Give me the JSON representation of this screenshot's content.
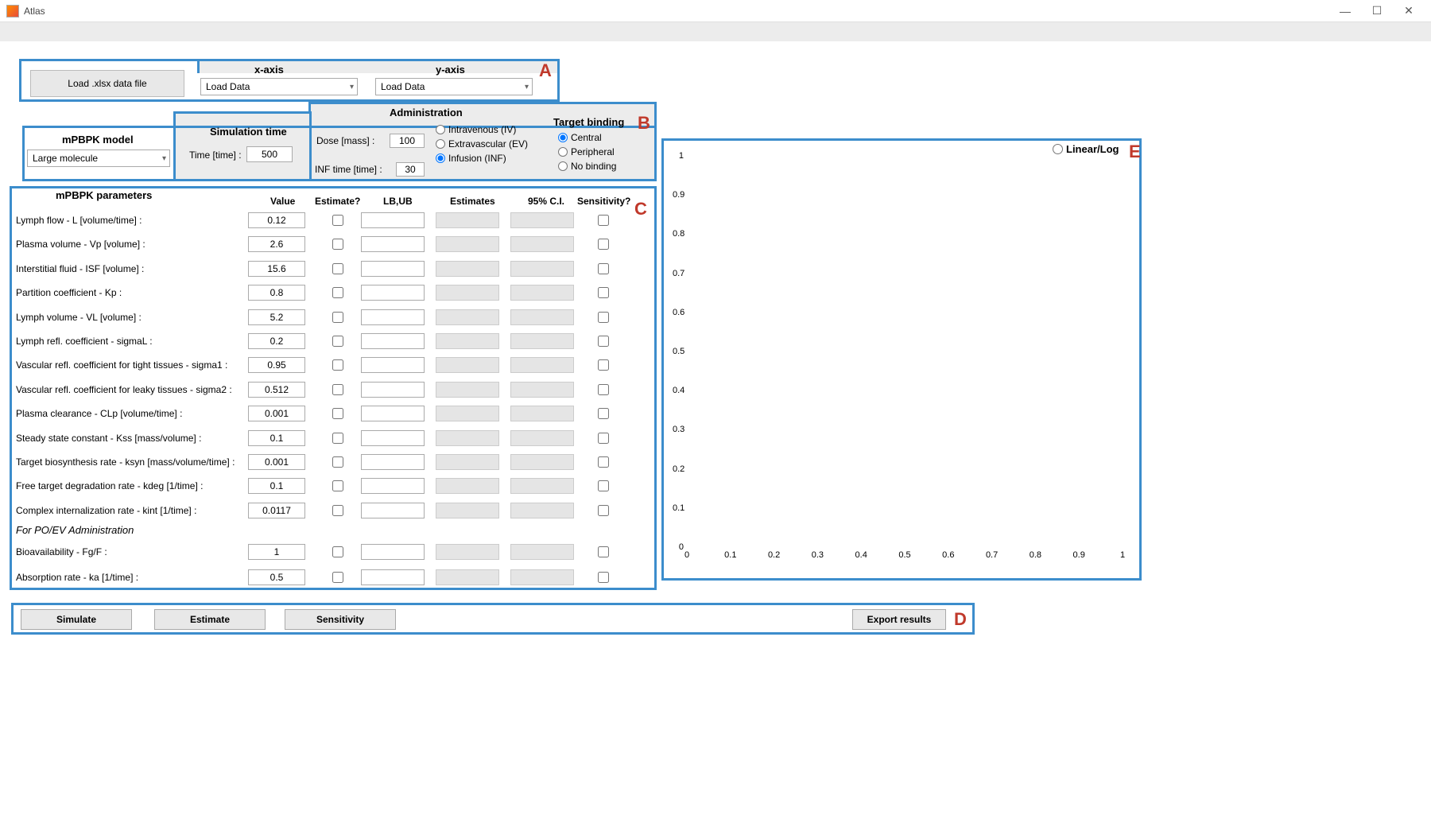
{
  "window": {
    "title": "Atlas"
  },
  "sectionA": {
    "load_button": "Load .xlsx data file",
    "xaxis_label": "x-axis",
    "yaxis_label": "y-axis",
    "xaxis_value": "Load Data",
    "yaxis_value": "Load Data",
    "letter": "A"
  },
  "sectionB": {
    "letter": "B",
    "model_title": "mPBPK model",
    "model_value": "Large molecule",
    "simtime_title": "Simulation time",
    "time_label": "Time [time] :",
    "time_value": "500",
    "admin_title": "Administration",
    "dose_label": "Dose [mass] :",
    "dose_value": "100",
    "inf_label": "INF time [time] :",
    "inf_value": "30",
    "admin_options": {
      "iv": "Intravenous (IV)",
      "ev": "Extravascular (EV)",
      "inf": "Infusion (INF)"
    },
    "admin_selected": "inf",
    "target_title": "Target binding",
    "target_options": {
      "central": "Central",
      "peripheral": "Peripheral",
      "none": "No binding"
    },
    "target_selected": "central"
  },
  "sectionC": {
    "letter": "C",
    "title": "mPBPK parameters",
    "headers": {
      "value": "Value",
      "estimate": "Estimate?",
      "lbub": "LB,UB",
      "estimates": "Estimates",
      "ci": "95% C.I.",
      "sensitivity": "Sensitivity?"
    },
    "params": [
      {
        "label": "Lymph flow - L [volume/time] :",
        "value": "0.12"
      },
      {
        "label": "Plasma volume - Vp [volume] :",
        "value": "2.6"
      },
      {
        "label": "Interstitial fluid - ISF [volume] :",
        "value": "15.6"
      },
      {
        "label": "Partition coefficient - Kp :",
        "value": "0.8"
      },
      {
        "label": "Lymph volume - VL [volume] :",
        "value": "5.2"
      },
      {
        "label": "Lymph refl. coefficient - sigmaL :",
        "value": "0.2"
      },
      {
        "label": "Vascular refl. coefficient for tight tissues - sigma1 :",
        "value": "0.95"
      },
      {
        "label": "Vascular refl. coefficient for leaky tissues - sigma2 :",
        "value": "0.512"
      },
      {
        "label": "Plasma clearance - CLp [volume/time] :",
        "value": "0.001"
      },
      {
        "label": "Steady state constant - Kss [mass/volume] :",
        "value": "0.1"
      },
      {
        "label": "Target biosynthesis rate - ksyn [mass/volume/time] :",
        "value": "0.001"
      },
      {
        "label": "Free target degradation rate - kdeg [1/time] :",
        "value": "0.1"
      },
      {
        "label": "Complex internalization rate - kint [1/time] :",
        "value": "0.0117"
      }
    ],
    "poev_header": "For PO/EV Administration",
    "poev_params": [
      {
        "label": "Bioavailability - Fg/F :",
        "value": "1"
      },
      {
        "label": "Absorption rate - ka [1/time] :",
        "value": "0.5"
      }
    ]
  },
  "sectionD": {
    "letter": "D",
    "simulate": "Simulate",
    "estimate": "Estimate",
    "sensitivity": "Sensitivity",
    "export": "Export results"
  },
  "sectionE": {
    "letter": "E",
    "linlog": "Linear/Log"
  },
  "chart_data": {
    "type": "scatter",
    "x": [],
    "y": [],
    "title": "",
    "xlabel": "",
    "ylabel": "",
    "xlim": [
      0,
      1
    ],
    "ylim": [
      0,
      1
    ],
    "xticks": [
      0,
      0.1,
      0.2,
      0.3,
      0.4,
      0.5,
      0.6,
      0.7,
      0.8,
      0.9,
      1
    ],
    "yticks": [
      0,
      0.1,
      0.2,
      0.3,
      0.4,
      0.5,
      0.6,
      0.7,
      0.8,
      0.9,
      1
    ]
  }
}
